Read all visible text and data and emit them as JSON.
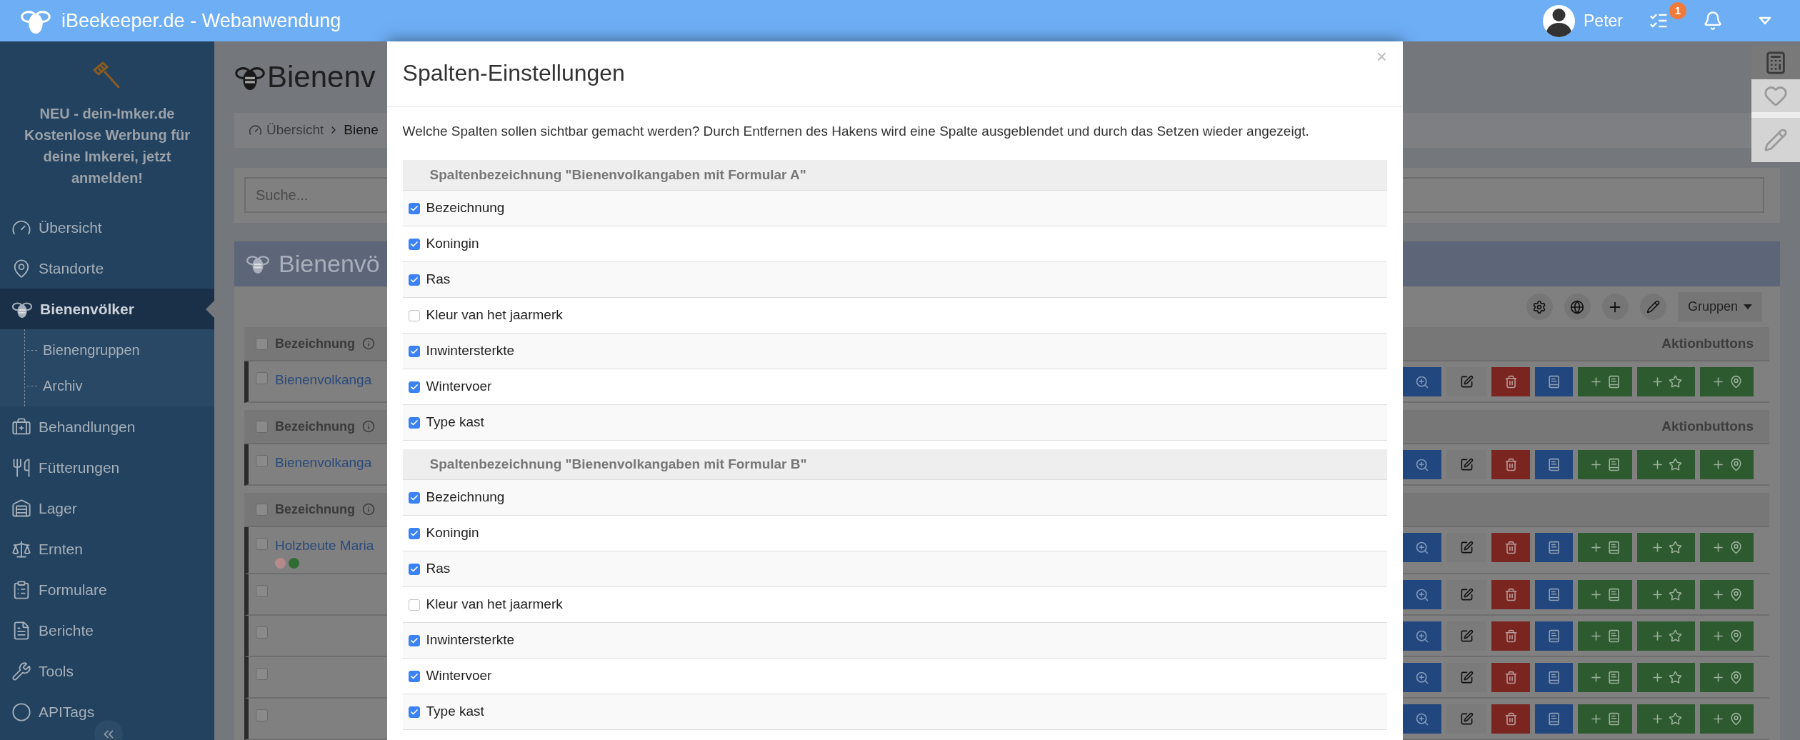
{
  "header": {
    "title": "iBeekeeper.de - Webanwendung",
    "user": "Peter",
    "tasks_badge": "1"
  },
  "sidebar": {
    "promo": "NEU - dein-Imker.de Kostenlose Werbung für deine Imkerei, jetzt anmelden!",
    "items": [
      {
        "label": "Übersicht",
        "selected": false
      },
      {
        "label": "Standorte",
        "selected": false
      },
      {
        "label": "Bienenvölker",
        "selected": true,
        "children": [
          {
            "label": "Bienengruppen",
            "selected": false
          },
          {
            "label": "Archiv",
            "selected": false
          }
        ]
      },
      {
        "label": "Behandlungen",
        "selected": false
      },
      {
        "label": "Fütterungen",
        "selected": false
      },
      {
        "label": "Lager",
        "selected": false
      },
      {
        "label": "Ernten",
        "selected": false
      },
      {
        "label": "Formulare",
        "selected": false
      },
      {
        "label": "Berichte",
        "selected": false
      },
      {
        "label": "Tools",
        "selected": false
      },
      {
        "label": "APITags",
        "selected": false
      }
    ]
  },
  "page": {
    "title": "Bienenv",
    "breadcrumb": [
      "Übersicht",
      "Biene"
    ],
    "search": {
      "placeholder": "Suche..."
    },
    "panel_title": "Bienenvö",
    "groups_button": "Gruppen",
    "groups": [
      {
        "header": "Bezeichnung",
        "actions_header": "Aktionbuttons",
        "checked": false,
        "rows": [
          {
            "name": "Bienenvolkanga",
            "checked": false
          }
        ]
      },
      {
        "header": "Bezeichnung",
        "actions_header": "Aktionbuttons",
        "checked": false,
        "rows": [
          {
            "name": "Bienenvolkanga",
            "checked": false
          }
        ]
      },
      {
        "header": "Bezeichnung",
        "checked": false,
        "rows": [
          {
            "name": "Holzbeute Maria",
            "checked": false,
            "dots": [
              {
                "color": "#b58a8a"
              },
              {
                "color": "#2f6b33"
              }
            ]
          },
          {
            "checked": false
          },
          {
            "checked": false
          },
          {
            "checked": false
          },
          {
            "checked": false
          }
        ]
      }
    ]
  },
  "modal": {
    "title": "Spalten-Einstellungen",
    "close": "×",
    "description": "Welche Spalten sollen sichtbar gemacht werden? Durch Entfernen des Hakens wird eine Spalte ausgeblendet und durch das Setzen wieder angezeigt.",
    "sections": [
      {
        "title": "Spaltenbezeichnung \"Bienenvolkangaben mit Formular A\"",
        "columns": [
          {
            "label": "Bezeichnung",
            "checked": true
          },
          {
            "label": "Koningin",
            "checked": true
          },
          {
            "label": "Ras",
            "checked": true
          },
          {
            "label": "Kleur van het jaarmerk",
            "checked": false
          },
          {
            "label": "Inwintersterkte",
            "checked": true
          },
          {
            "label": "Wintervoer",
            "checked": true
          },
          {
            "label": "Type kast",
            "checked": true
          }
        ]
      },
      {
        "title": "Spaltenbezeichnung \"Bienenvolkangaben mit Formular B\"",
        "columns": [
          {
            "label": "Bezeichnung",
            "checked": true
          },
          {
            "label": "Koningin",
            "checked": true
          },
          {
            "label": "Ras",
            "checked": true
          },
          {
            "label": "Kleur van het jaarmerk",
            "checked": false
          },
          {
            "label": "Inwintersterkte",
            "checked": true
          },
          {
            "label": "Wintervoer",
            "checked": true
          },
          {
            "label": "Type kast",
            "checked": true
          }
        ]
      }
    ]
  }
}
